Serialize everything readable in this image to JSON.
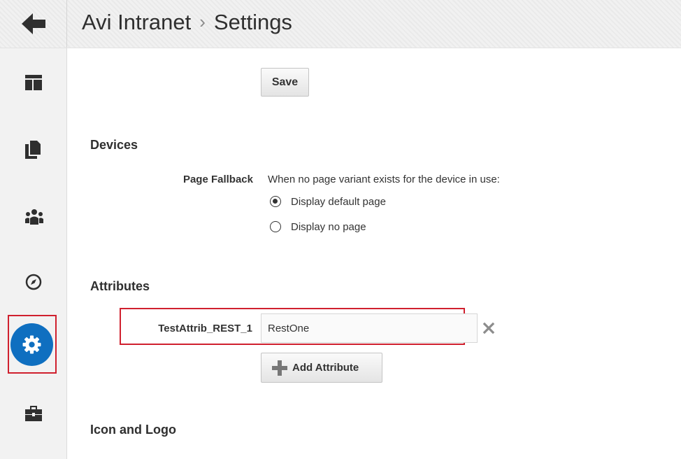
{
  "header": {
    "breadcrumb": [
      "Avi Intranet",
      "Settings"
    ],
    "separator": "›"
  },
  "sidebar": {
    "items": [
      {
        "icon": "layout-icon",
        "active": false
      },
      {
        "icon": "pages-icon",
        "active": false
      },
      {
        "icon": "people-icon",
        "active": false
      },
      {
        "icon": "compass-icon",
        "active": false
      },
      {
        "icon": "gear-icon",
        "active": true
      },
      {
        "icon": "toolbox-icon",
        "active": false
      }
    ]
  },
  "toolbar": {
    "save_label": "Save"
  },
  "devices": {
    "title": "Devices",
    "page_fallback_label": "Page Fallback",
    "page_fallback_desc": "When no page variant exists for the device in use:",
    "options": [
      {
        "label": "Display default page",
        "checked": true
      },
      {
        "label": "Display no page",
        "checked": false
      }
    ]
  },
  "attributes": {
    "title": "Attributes",
    "items": [
      {
        "name": "TestAttrib_REST_1",
        "value": "RestOne"
      }
    ],
    "add_label": "Add Attribute"
  },
  "icon_logo": {
    "title": "Icon and Logo"
  },
  "colors": {
    "accent": "#0f6fc0",
    "highlight": "#d0202e"
  }
}
